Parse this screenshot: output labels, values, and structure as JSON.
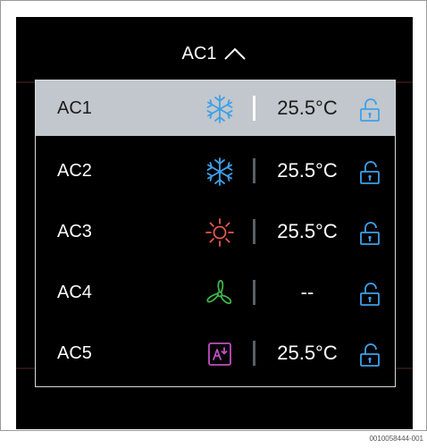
{
  "header": {
    "title": "AC1"
  },
  "units": [
    {
      "name": "AC1",
      "mode_icon": "snowflake-icon",
      "temperature": "25.5°C",
      "lock_icon": "unlocked-padlock-icon",
      "selected": true
    },
    {
      "name": "AC2",
      "mode_icon": "snowflake-icon",
      "temperature": "25.5°C",
      "lock_icon": "unlocked-padlock-icon",
      "selected": false
    },
    {
      "name": "AC3",
      "mode_icon": "sun-icon",
      "temperature": "25.5°C",
      "lock_icon": "unlocked-padlock-icon",
      "selected": false
    },
    {
      "name": "AC4",
      "mode_icon": "fan-icon",
      "temperature": "--",
      "lock_icon": "unlocked-padlock-icon",
      "selected": false
    },
    {
      "name": "AC5",
      "mode_icon": "auto-mode-icon",
      "temperature": "25.5°C",
      "lock_icon": "unlocked-padlock-icon",
      "selected": false
    }
  ],
  "colors": {
    "cool": "#3fa0e8",
    "heat": "#e8574f",
    "fan": "#3fb54a",
    "auto": "#c04fc0",
    "lock": "#3fa0e8",
    "selected_row": "#c1c7cc"
  },
  "caption": "0010058444-001"
}
